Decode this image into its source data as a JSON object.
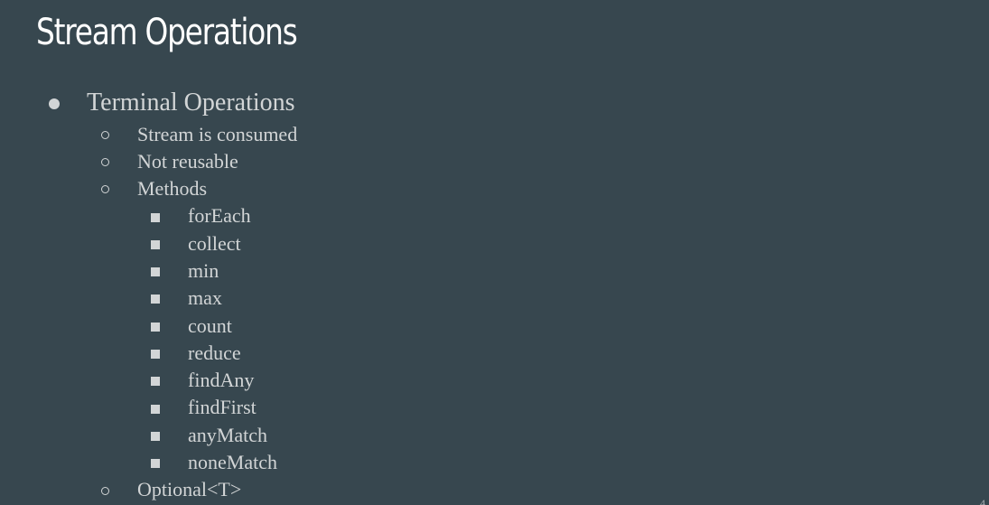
{
  "slide": {
    "title": "Stream Operations",
    "page_number": "4"
  },
  "outline": {
    "level1": "Terminal Operations",
    "level2": [
      "Stream is consumed",
      "Not reusable",
      "Methods"
    ],
    "methods": [
      "forEach",
      "collect",
      "min",
      "max",
      "count",
      "reduce",
      "findAny",
      "findFirst",
      "anyMatch",
      "noneMatch"
    ],
    "last_level2": "Optional<T>"
  },
  "colors": {
    "background": "#37474f",
    "title": "#ffffff",
    "body_text": "#d2d5d6"
  }
}
